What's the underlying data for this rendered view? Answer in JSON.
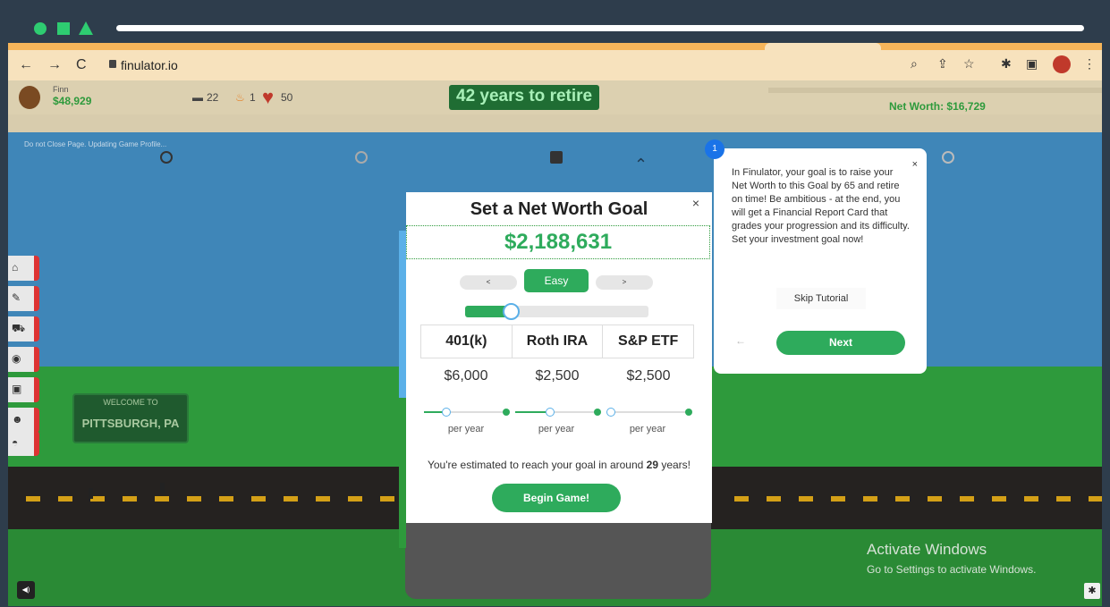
{
  "browser": {
    "url": "finulator.io"
  },
  "game": {
    "player_name": "Finn",
    "player_cash": "$48,929",
    "stat_cake": "22",
    "stat_fire": "1",
    "stat_heart": "50",
    "years_to_retire": "42 years to retire",
    "net_worth": "Net Worth: $16,729",
    "updating_notice": "Do not Close Page. Updating Game Profile...",
    "sign_top": "WELCOME TO",
    "sign_main": "PITTSBURGH, PA"
  },
  "modal": {
    "title": "Set a Net Worth Goal",
    "close": "×",
    "goal_value": "$2,188,631",
    "difficulty_prev": "<",
    "difficulty_label": "Easy",
    "difficulty_next": ">",
    "difficulty_progress": 0.25,
    "accounts": [
      {
        "name": "401(k)",
        "amount": "$6,000",
        "period": "per year"
      },
      {
        "name": "Roth IRA",
        "amount": "$2,500",
        "period": "per year"
      },
      {
        "name": "S&P ETF",
        "amount": "$2,500",
        "period": "per year"
      }
    ],
    "estimate_prefix": "You're estimated to reach your goal in around ",
    "estimate_years": "29",
    "estimate_suffix": " years!",
    "begin_label": "Begin Game!"
  },
  "tutorial": {
    "step": "1",
    "close": "×",
    "text": "In Finulator, your goal is to raise your Net Worth to this Goal by 65 and retire on time! Be ambitious - at the end, you will get a Financial Report Card that grades your progression and its difficulty. Set your investment goal now!",
    "skip_label": "Skip Tutorial",
    "back_label": "←",
    "next_label": "Next"
  },
  "windows": {
    "activate_title": "Activate Windows",
    "activate_sub": "Go to Settings to activate Windows."
  },
  "colors": {
    "accent_green": "#2eab5c",
    "sky": "#3f86b8",
    "grass": "#2e9a3c"
  }
}
